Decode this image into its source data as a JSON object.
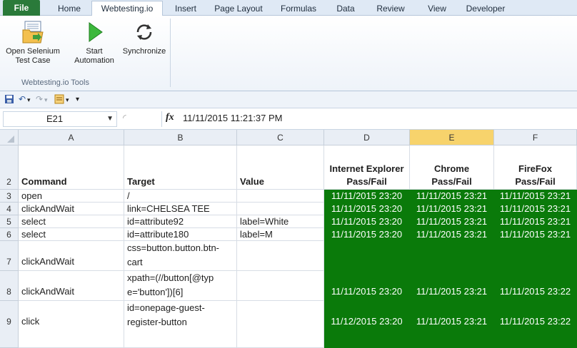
{
  "ribbon_tabs": [
    "File",
    "Home",
    "Webtesting.io",
    "Insert",
    "Page Layout",
    "Formulas",
    "Data",
    "Review",
    "View",
    "Developer"
  ],
  "ribbon": {
    "buttons": [
      {
        "line1": "Open Selenium",
        "line2": "Test Case",
        "icon": "folder-open-icon"
      },
      {
        "line1": "Start",
        "line2": "Automation",
        "icon": "play-icon"
      },
      {
        "line1": "Synchronize",
        "line2": "",
        "icon": "sync-icon"
      }
    ],
    "group_label": "Webtesting.io Tools"
  },
  "formula_bar": {
    "name_box": "E21",
    "fx": "fx",
    "value": "11/11/2015  11:21:37 PM"
  },
  "columns": [
    "A",
    "B",
    "C",
    "D",
    "E",
    "F"
  ],
  "selected_column": "E",
  "header_row": {
    "row_number": "2",
    "command": "Command",
    "target": "Target",
    "value": "Value",
    "ie_line1": "Internet Explorer",
    "ie_line2": "Pass/Fail",
    "chrome_line1": "Chrome",
    "chrome_line2": "Pass/Fail",
    "firefox_line1": "FireFox",
    "firefox_line2": "Pass/Fail"
  },
  "rows": [
    {
      "num": "3",
      "command": "open",
      "target": "/",
      "value": "",
      "ie": "11/11/2015 23:20",
      "chrome": "11/11/2015 23:21",
      "firefox": "11/11/2015 23:21"
    },
    {
      "num": "4",
      "command": "clickAndWait",
      "target": "link=CHELSEA TEE",
      "value": "",
      "ie": "11/11/2015 23:20",
      "chrome": "11/11/2015 23:21",
      "firefox": "11/11/2015 23:21"
    },
    {
      "num": "5",
      "command": "select",
      "target": "id=attribute92",
      "value": "label=White",
      "ie": "11/11/2015 23:20",
      "chrome": "11/11/2015 23:21",
      "firefox": "11/11/2015 23:21"
    },
    {
      "num": "6",
      "command": "select",
      "target": "id=attribute180",
      "value": "label=M",
      "ie": "11/11/2015 23:20",
      "chrome": "11/11/2015 23:21",
      "firefox": "11/11/2015 23:21"
    },
    {
      "num": "7",
      "command": "clickAndWait",
      "target_line1": "css=button.button.btn-",
      "target_line2": "cart",
      "value": "",
      "ie": "",
      "chrome": "",
      "firefox": ""
    },
    {
      "num": "8",
      "command": "clickAndWait",
      "target_line1": "xpath=(//button[@typ",
      "target_line2": "e='button'])[6]",
      "value": "",
      "ie": "11/11/2015 23:20",
      "chrome": "11/11/2015 23:21",
      "firefox": "11/11/2015 23:22"
    },
    {
      "num": "9",
      "command": "click",
      "target_line1": "id=onepage-guest-",
      "target_line2": "register-button",
      "value": "",
      "ie": "11/12/2015 23:20",
      "chrome": "11/11/2015 23:21",
      "firefox": "11/11/2015 23:22"
    }
  ],
  "colors": {
    "pass_green": "#0a7a0a",
    "file_tab": "#2a7a3a",
    "selected_header": "#f7d36c"
  }
}
